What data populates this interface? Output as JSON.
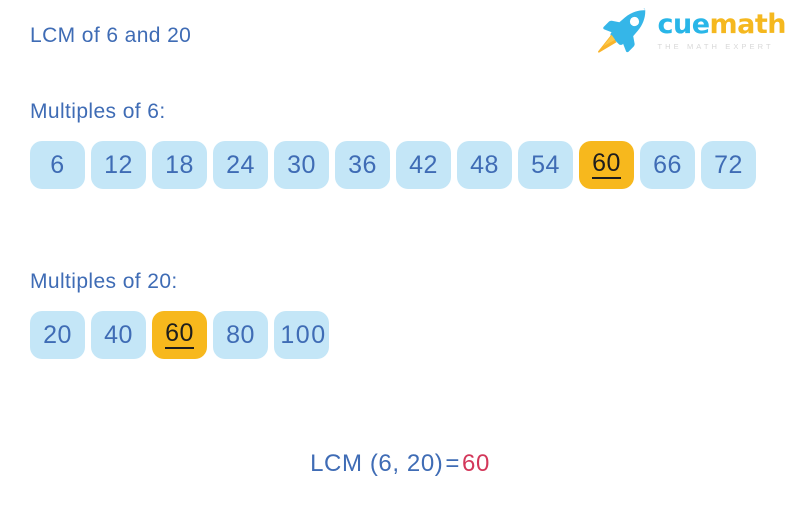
{
  "header": {
    "title": "LCM of 6 and 20"
  },
  "logo": {
    "icon": "rocket-icon",
    "word_primary": "cue",
    "word_secondary": "math",
    "tagline": "THE MATH EXPERT",
    "colors": {
      "primary": "#29b6e8",
      "secondary": "#f5b81f",
      "tagline": "#d8d8d8"
    }
  },
  "theme": {
    "box_background": "#c4e6f7",
    "box_text": "#3f6cb5",
    "highlight_background": "#f7b81d",
    "highlight_text": "#1d1d1d",
    "label_text": "#3f6cb5",
    "result_value_color": "#d3375a"
  },
  "sections": [
    {
      "label": "Multiples of 6:",
      "values": [
        "6",
        "12",
        "18",
        "24",
        "30",
        "36",
        "42",
        "48",
        "54",
        "60",
        "66",
        "72"
      ],
      "highlight_index": 9
    },
    {
      "label": "Multiples of 20:",
      "values": [
        "20",
        "40",
        "60",
        "80",
        "100"
      ],
      "highlight_index": 2
    }
  ],
  "result": {
    "expression": "LCM (6, 20)",
    "operator": "=",
    "value": "60"
  }
}
